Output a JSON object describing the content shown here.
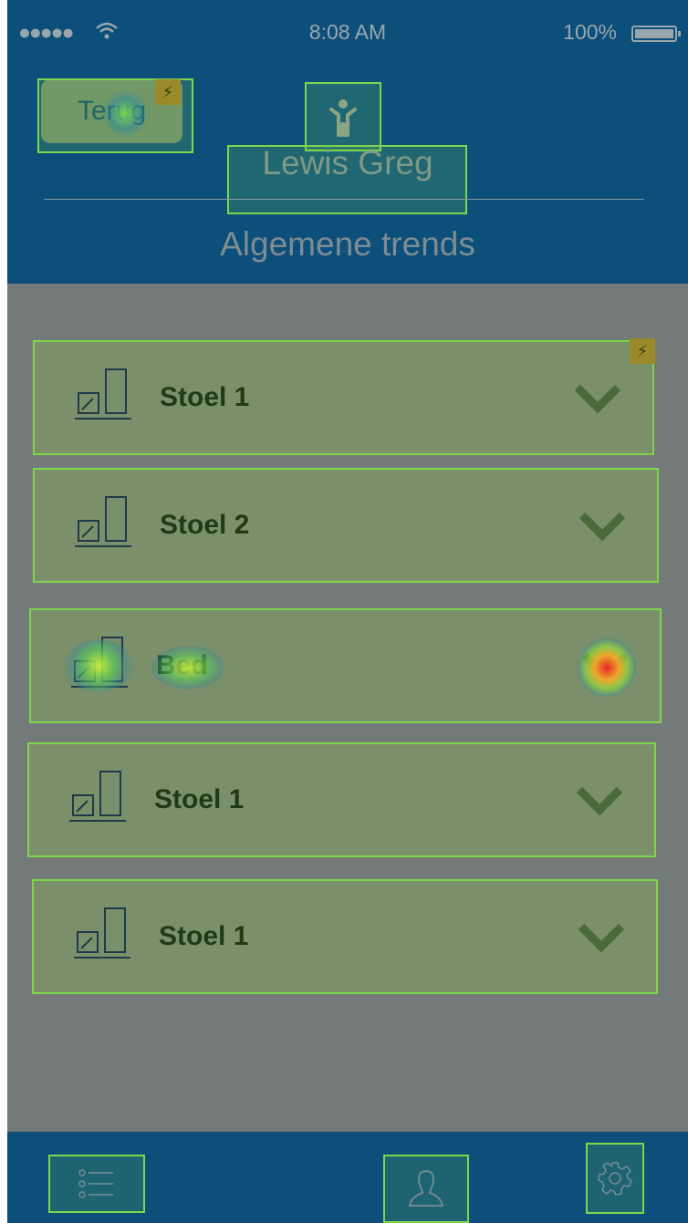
{
  "status_bar": {
    "signal": "●●●●●",
    "time": "8:08 AM",
    "battery": "100%"
  },
  "header": {
    "back_label": "Terug",
    "patient_name": "Lewis Greg",
    "title": "Algemene trends"
  },
  "items": [
    {
      "label": "Stoel 1",
      "icon": "chart-bar-icon"
    },
    {
      "label": "Stoel 2",
      "icon": "chart-bar-icon"
    },
    {
      "label": "Bed",
      "icon": "chart-bar-icon"
    },
    {
      "label": "Stoel 1",
      "icon": "chart-bar-icon"
    },
    {
      "label": "Stoel 1",
      "icon": "chart-bar-icon"
    }
  ],
  "tabbar": {
    "icons": [
      "list-icon",
      "user-icon",
      "gear-icon"
    ]
  },
  "colors": {
    "header": "#0c4f7a",
    "background": "#737a79",
    "item_fill": "#7b8f6a",
    "overlay_border": "#7fd64b"
  }
}
